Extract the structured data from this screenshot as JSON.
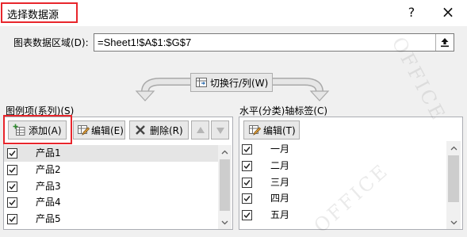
{
  "window": {
    "title": "选择数据源",
    "help_label": "?",
    "close_label": "×"
  },
  "data_range": {
    "label": "图表数据区域(D):",
    "value": "=Sheet1!$A$1:$G$7",
    "collapse_icon": "collapse-dialog-icon"
  },
  "switch_button": {
    "label": "切换行/列(W)",
    "icon": "switch-row-column-icon"
  },
  "legend": {
    "header": "图例项(系列)(S)",
    "toolbar": {
      "add_label": "添加(A)",
      "edit_label": "编辑(E)",
      "delete_label": "删除(R)",
      "move_up_enabled": false,
      "move_down_enabled": false
    },
    "items": [
      {
        "label": "产品1",
        "checked": true,
        "selected": true
      },
      {
        "label": "产品2",
        "checked": true,
        "selected": false
      },
      {
        "label": "产品3",
        "checked": true,
        "selected": false
      },
      {
        "label": "产品4",
        "checked": true,
        "selected": false
      },
      {
        "label": "产品5",
        "checked": true,
        "selected": false
      }
    ]
  },
  "axis": {
    "header": "水平(分类)轴标签(C)",
    "toolbar": {
      "edit_label": "编辑(T)"
    },
    "items": [
      {
        "label": "一月",
        "checked": true,
        "selected": false
      },
      {
        "label": "二月",
        "checked": true,
        "selected": false
      },
      {
        "label": "三月",
        "checked": true,
        "selected": false
      },
      {
        "label": "四月",
        "checked": true,
        "selected": false
      },
      {
        "label": "五月",
        "checked": true,
        "selected": false
      }
    ]
  },
  "colors": {
    "annotation": "#e8262c",
    "selection": "#e5e5e5",
    "button_face": "#e8e8e8",
    "button_border": "#adadad"
  },
  "watermark": {
    "text": "OFFICE"
  }
}
